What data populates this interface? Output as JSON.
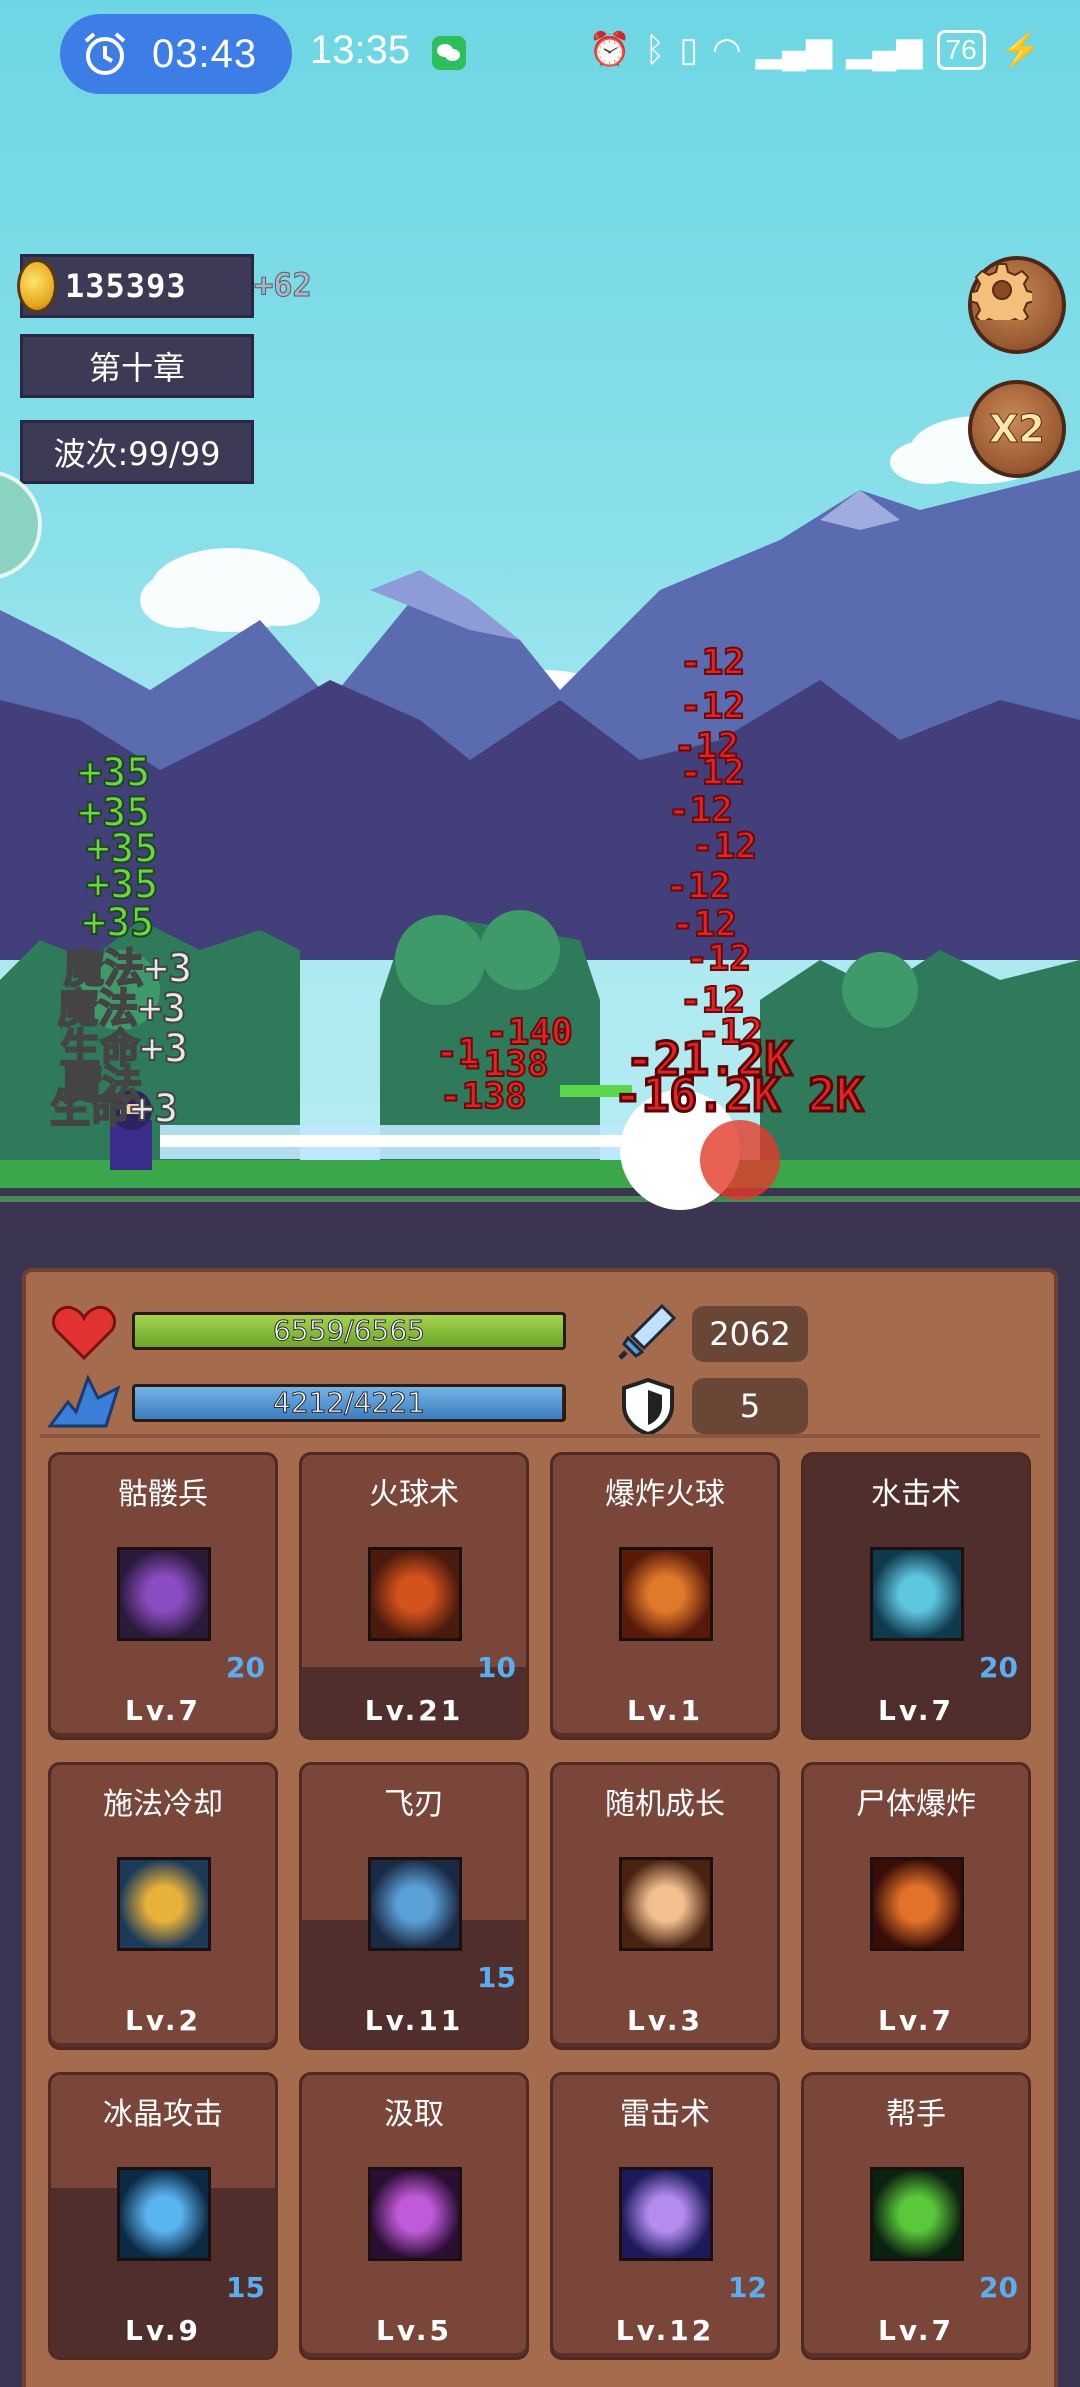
{
  "status_bar": {
    "timer": "03:43",
    "clock": "13:35",
    "battery": "76"
  },
  "hud": {
    "gold": "135393",
    "gold_gain": "+62",
    "chapter": "第十章",
    "wave": "波次:99/99",
    "speed_label": "X2"
  },
  "floating_text": {
    "heals": [
      "+35",
      "+35",
      "+35",
      "+35",
      "+35"
    ],
    "buffs": [
      "魔法+3",
      "魔法+3",
      "生命+3",
      "魔法",
      "生命+3"
    ],
    "damage_small": [
      "-12",
      "-12",
      "-12",
      "-12",
      "-12",
      "-12",
      "-12",
      "-12",
      "-12",
      "-12",
      "-12"
    ],
    "damage_mid": [
      "-140",
      "-138",
      "-138",
      "-1"
    ],
    "damage_big": [
      "-21.2K",
      "-16.2K",
      "2K"
    ]
  },
  "stats": {
    "hp_text": "6559/6565",
    "hp_fraction": 0.9991,
    "mp_text": "4212/4221",
    "mp_fraction": 0.9979,
    "attack": "2062",
    "defense": "5"
  },
  "skills": [
    {
      "name": "骷髅兵",
      "level": "Lv.7",
      "count": "20",
      "icon": "skeleton-hand-icon",
      "colors": [
        "#2c1a3c",
        "#8a4cc0"
      ],
      "shade": 0
    },
    {
      "name": "火球术",
      "level": "Lv.21",
      "count": "10",
      "icon": "fireball-icon",
      "colors": [
        "#4a1a0c",
        "#d4521c"
      ],
      "shade": 0.25
    },
    {
      "name": "爆炸火球",
      "level": "Lv.1",
      "count": "",
      "icon": "explosion-fireball-icon",
      "colors": [
        "#5a1a0a",
        "#e07a2a"
      ],
      "shade": 0
    },
    {
      "name": "水击术",
      "level": "Lv.7",
      "count": "20",
      "icon": "water-swirl-icon",
      "colors": [
        "#0e3a4e",
        "#5ec7e0"
      ],
      "shade": 1
    },
    {
      "name": "施法冷却",
      "level": "Lv.2",
      "count": "",
      "icon": "lightning-cooldown-icon",
      "colors": [
        "#1c3a5a",
        "#e8b23a"
      ],
      "shade": 0
    },
    {
      "name": "飞刃",
      "level": "Lv.11",
      "count": "15",
      "icon": "flying-blade-icon",
      "colors": [
        "#1a2a44",
        "#5aa0d8"
      ],
      "shade": 0.45
    },
    {
      "name": "随机成长",
      "level": "Lv.3",
      "count": "",
      "icon": "fist-growth-icon",
      "colors": [
        "#4a2210",
        "#f2c090"
      ],
      "shade": 0
    },
    {
      "name": "尸体爆炸",
      "level": "Lv.7",
      "count": "",
      "icon": "corpse-explosion-icon",
      "colors": [
        "#3a0e08",
        "#e2722a"
      ],
      "shade": 0
    },
    {
      "name": "冰晶攻击",
      "level": "Lv.9",
      "count": "15",
      "icon": "ice-crystal-icon",
      "colors": [
        "#0c2a44",
        "#5ab4f0"
      ],
      "shade": 0.6
    },
    {
      "name": "汲取",
      "level": "Lv.5",
      "count": "",
      "icon": "drain-vortex-icon",
      "colors": [
        "#2a0e34",
        "#c05ad8"
      ],
      "shade": 0
    },
    {
      "name": "雷击术",
      "level": "Lv.12",
      "count": "12",
      "icon": "thunder-strike-icon",
      "colors": [
        "#1c1a5a",
        "#b48cf0"
      ],
      "shade": 0
    },
    {
      "name": "帮手",
      "level": "Lv.7",
      "count": "20",
      "icon": "slime-helper-icon",
      "colors": [
        "#0c2210",
        "#5ac83a"
      ],
      "shade": 0
    }
  ]
}
